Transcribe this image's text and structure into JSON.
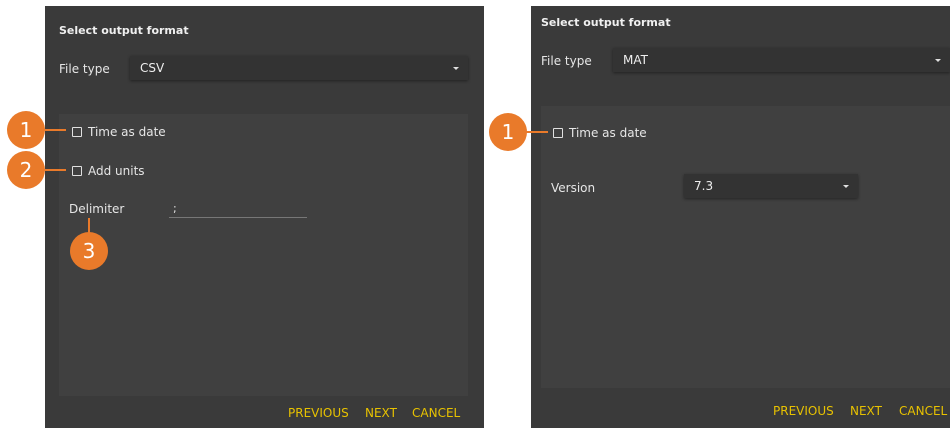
{
  "left": {
    "title": "Select output format",
    "file_type_label": "File type",
    "file_type_value": "CSV",
    "time_as_date_label": "Time as date",
    "time_as_date_checked": false,
    "add_units_label": "Add units",
    "add_units_checked": false,
    "delimiter_label": "Delimiter",
    "delimiter_value": ";",
    "previous_label": "PREVIOUS",
    "next_label": "NEXT",
    "cancel_label": "CANCEL"
  },
  "right": {
    "title": "Select output format",
    "file_type_label": "File type",
    "file_type_value": "MAT",
    "time_as_date_label": "Time as date",
    "time_as_date_checked": false,
    "version_label": "Version",
    "version_value": "7.3",
    "previous_label": "PREVIOUS",
    "next_label": "NEXT",
    "cancel_label": "CANCEL"
  },
  "callouts": {
    "left": [
      "1",
      "2",
      "3"
    ],
    "right": [
      "1"
    ]
  },
  "colors": {
    "panel_bg": "#3a3a3a",
    "inner_bg": "#404040",
    "accent_yellow": "#e8c200",
    "callout_orange": "#e97a2a"
  },
  "icons": {
    "dropdown": "chevron-down-icon",
    "checkbox": "checkbox-unchecked-icon"
  }
}
